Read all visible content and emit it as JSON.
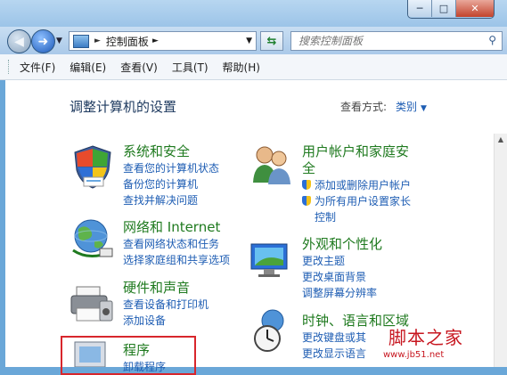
{
  "window": {
    "buttons": [
      "─",
      "□",
      "✕"
    ]
  },
  "nav": {
    "address_text": "控制面板",
    "search_placeholder": "搜索控制面板"
  },
  "menu": [
    "文件(F)",
    "编辑(E)",
    "查看(V)",
    "工具(T)",
    "帮助(H)"
  ],
  "content": {
    "heading": "调整计算机的设置",
    "view_by_label": "查看方式:",
    "view_by_value": "类别"
  },
  "categories_left": [
    {
      "title": "系统和安全",
      "links": [
        "查看您的计算机状态",
        "备份您的计算机",
        "查找并解决问题"
      ],
      "icon": "shield-icon"
    },
    {
      "title": "网络和 Internet",
      "links": [
        "查看网络状态和任务",
        "选择家庭组和共享选项"
      ],
      "icon": "network-globe-icon"
    },
    {
      "title": "硬件和声音",
      "links": [
        "查看设备和打印机",
        "添加设备"
      ],
      "icon": "printer-icon"
    },
    {
      "title": "程序",
      "links": [
        "卸载程序"
      ],
      "icon": "programs-icon"
    }
  ],
  "categories_right": [
    {
      "title_line1": "用户帐户和家庭安",
      "title_line2": "全",
      "links": [
        "添加或删除用户帐户",
        "为所有用户设置家长",
        "控制"
      ],
      "icon": "users-icon"
    },
    {
      "title": "外观和个性化",
      "links": [
        "更改主题",
        "更改桌面背景",
        "调整屏幕分辨率"
      ],
      "icon": "appearance-icon"
    },
    {
      "title": "时钟、语言和区域",
      "links": [
        "更改键盘或其",
        "更改显示语言"
      ],
      "icon": "clock-globe-icon"
    }
  ],
  "watermark": {
    "line1": "脚本之家",
    "line2": "www.jb51.net"
  }
}
